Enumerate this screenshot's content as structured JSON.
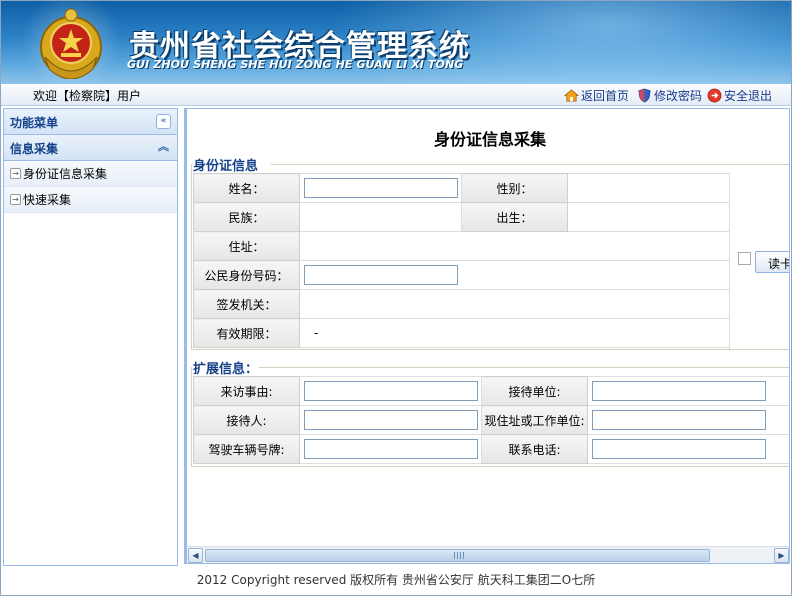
{
  "header": {
    "title_cn": "贵州省社会综合管理系统",
    "title_en": "GUI ZHOU SHENG SHE HUI ZONG HE GUAN LI XI TONG"
  },
  "topbar": {
    "welcome": "欢迎【检察院】用户",
    "links": {
      "home": "返回首页",
      "password": "修改密码",
      "logout": "安全退出"
    }
  },
  "sidebar": {
    "menu_title": "功能菜单",
    "group_title": "信息采集",
    "items": [
      {
        "label": "身份证信息采集"
      },
      {
        "label": "快速采集"
      }
    ]
  },
  "form": {
    "title": "身份证信息采集",
    "id_section": {
      "legend": "身份证信息",
      "name_label": "姓名：",
      "name_value": "",
      "gender_label": "性别：",
      "gender_value": "",
      "ethnicity_label": "民族：",
      "ethnicity_value": "",
      "birth_label": "出生：",
      "birth_value": "",
      "address_label": "住址：",
      "address_value": "",
      "idno_label": "公民身份号码：",
      "idno_value": "",
      "issuer_label": "签发机关：",
      "issuer_value": "",
      "validity_label": "有效期限：",
      "validity_value": "-",
      "read_button": "读卡"
    },
    "ext_section": {
      "legend": "扩展信息：",
      "reason_label": "来访事由:",
      "unit_label": "接待单位:",
      "receiver_label": "接待人:",
      "work_label": "现住址或工作单位:",
      "plate_label": "驾驶车辆号牌:",
      "phone_label": "联系电话:"
    }
  },
  "footer": {
    "copyright": "2012 Copyright reserved 版权所有 贵州省公安厅 航天科工集团二O七所"
  },
  "colors": {
    "header_blue": "#0d5fa5",
    "panel_border": "#99bbe8",
    "legend_text": "#15428b"
  }
}
